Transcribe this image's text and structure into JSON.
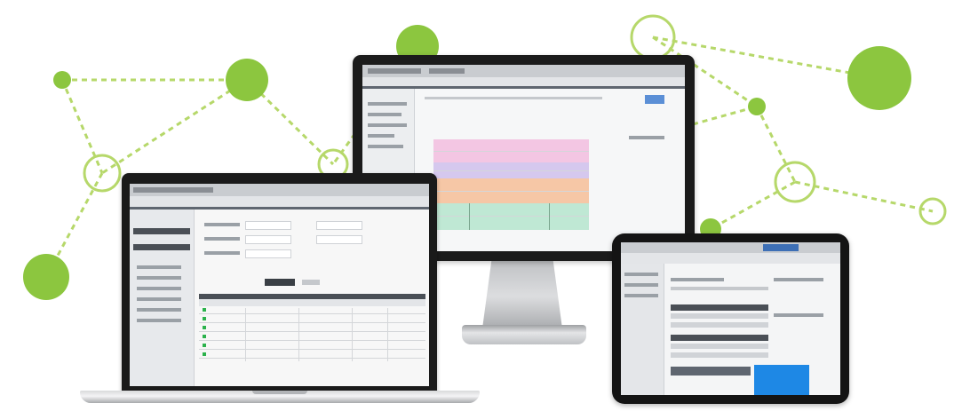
{
  "colors": {
    "node_green": "#8cc63f",
    "link_green": "#b6d86a",
    "device_black": "#1a1a1a",
    "status_green": "#2bb24c",
    "tablet_blue": "#1e88e5",
    "row_pink": "#f3c6e3",
    "row_lavender": "#d5c8ee",
    "row_peach": "#f6c7a6",
    "row_mint": "#bfe8d4"
  },
  "devices": {
    "monitor": {
      "icon": "desktop-monitor",
      "screen_icon": "dashboard-screen"
    },
    "laptop": {
      "icon": "laptop",
      "screen_icon": "table-screen"
    },
    "tablet": {
      "icon": "tablet",
      "screen_icon": "form-screen"
    }
  },
  "network": {
    "icon": "network-graph"
  }
}
